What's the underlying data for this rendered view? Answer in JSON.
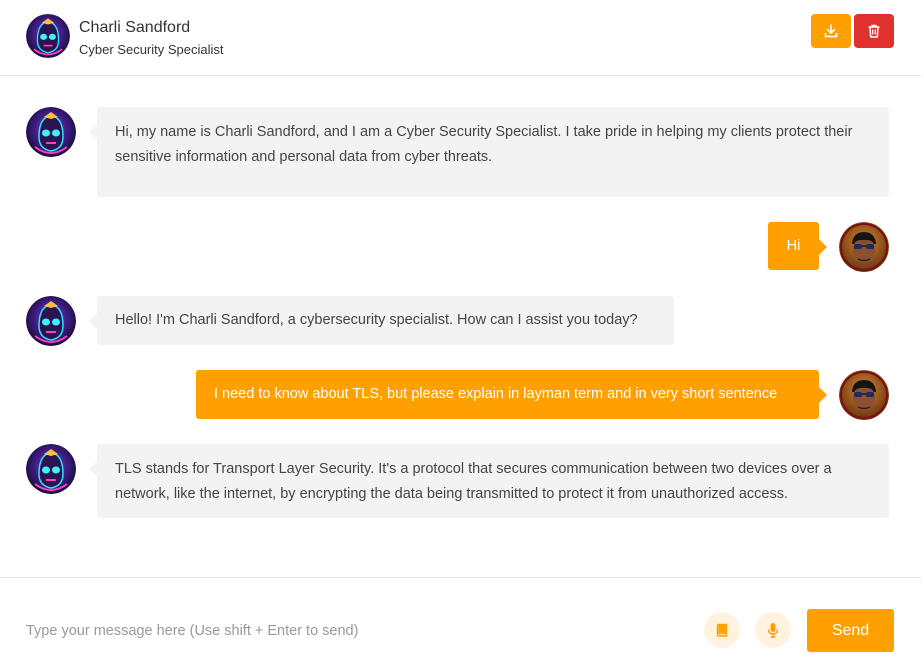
{
  "header": {
    "name": "Charli Sandford",
    "role": "Cyber Security Specialist",
    "download_icon": "download-icon",
    "delete_icon": "trash-icon"
  },
  "messages": [
    {
      "sender": "bot",
      "text": "Hi, my name is Charli Sandford, and I am a Cyber Security Specialist. I take pride in helping my clients protect their sensitive information and personal data from cyber threats."
    },
    {
      "sender": "user",
      "text": "Hi"
    },
    {
      "sender": "bot",
      "text": "Hello! I'm Charli Sandford, a cybersecurity specialist. How can I assist you today?"
    },
    {
      "sender": "user",
      "text": "I need to know about TLS, but please explain in layman term and in very short sentence"
    },
    {
      "sender": "bot",
      "text": "TLS stands for Transport Layer Security. It's a protocol that secures communication between two devices over a network, like the internet, by encrypting the data being transmitted to protect it from unauthorized access."
    }
  ],
  "footer": {
    "placeholder": "Type your message here (Use shift + Enter to send)",
    "send_label": "Send",
    "book_icon": "book-icon",
    "mic_icon": "microphone-icon"
  },
  "colors": {
    "accent": "#ffa000",
    "danger": "#e0312d",
    "bot_bubble": "#f3f3f3"
  }
}
